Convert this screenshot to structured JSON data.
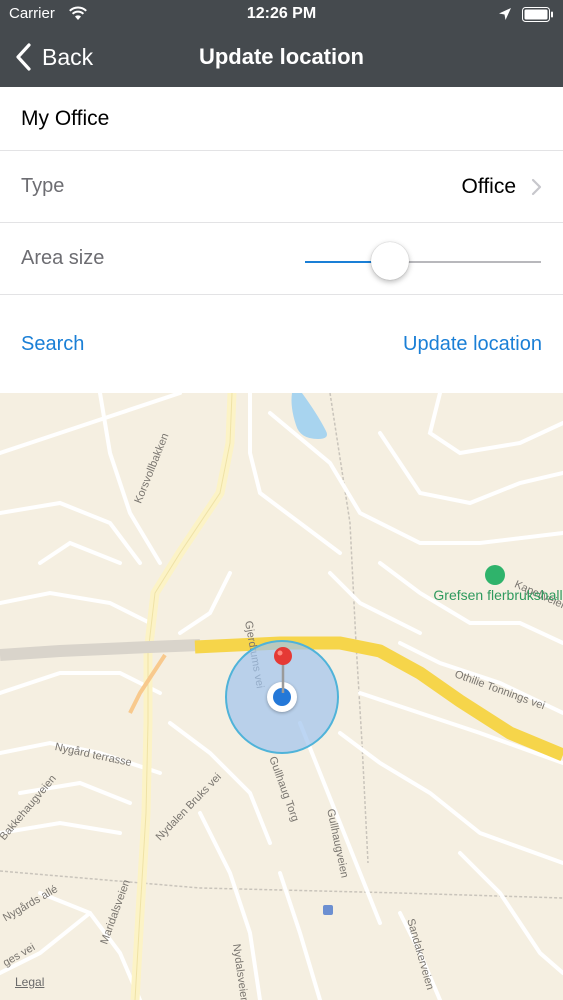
{
  "status_bar": {
    "carrier": "Carrier",
    "time": "12:26 PM"
  },
  "nav": {
    "back_label": "Back",
    "title": "Update location"
  },
  "form": {
    "name_value": "My Office",
    "type_label": "Type",
    "type_value": "Office",
    "area_label": "Area size",
    "area_slider_fraction": 0.36
  },
  "actions": {
    "search_label": "Search",
    "update_label": "Update location"
  },
  "map": {
    "streets": [
      "Korsvollbakken",
      "Kapellveien",
      "Othilie Tonnings vei",
      "Gjerdrums vei",
      "Gullhaug Torg",
      "Gullhaugveien",
      "Nygård terrasse",
      "Bakkehaugveien",
      "Nydalen Bruks vei",
      "Maridalsveien",
      "Nygårds allé",
      "Sandakerveien",
      "Nydalsveien",
      "ges vei"
    ],
    "poi_name": "Grefsen flerbrukshall",
    "legal": "Legal"
  },
  "colors": {
    "nav_bar": "#454a4e",
    "accent": "#1a7fd6",
    "map_bg": "#f5efe1",
    "highway": "#f6d54a",
    "poi": "#2fb36b",
    "pin": "#e53935"
  }
}
